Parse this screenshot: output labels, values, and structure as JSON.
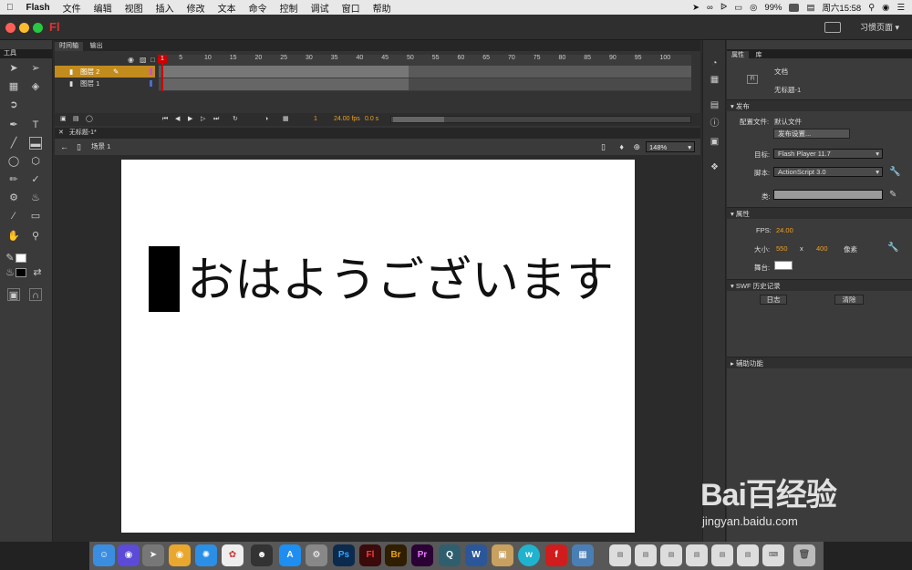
{
  "menubar": {
    "app": "Flash",
    "items": [
      "文件",
      "编辑",
      "视图",
      "插入",
      "修改",
      "文本",
      "命令",
      "控制",
      "调试",
      "窗口",
      "帮助"
    ],
    "battery": "99%",
    "clock": "周六15:58"
  },
  "titlebar": {
    "logo": "Fl",
    "workspace": "习惯页面 ▾"
  },
  "tools": {
    "title": "工具"
  },
  "timeline": {
    "tabs": [
      "时间轴",
      "输出"
    ],
    "layers": [
      "图层 2",
      "图层 1"
    ],
    "ticks": [
      "1",
      "5",
      "10",
      "15",
      "20",
      "25",
      "30",
      "35",
      "40",
      "45",
      "50",
      "55",
      "60",
      "65",
      "70",
      "75",
      "80",
      "85",
      "90",
      "95",
      "100"
    ],
    "current_frame": "1",
    "fps": "24.00 fps",
    "time": "0.0 s"
  },
  "document": {
    "tab": "无标题-1*",
    "scene": "场景 1",
    "zoom": "148%",
    "stage_text": "おはようございます"
  },
  "properties": {
    "tabs": [
      "属性",
      "库"
    ],
    "doc_label": "文档",
    "doc_name": "无标题-1",
    "publish_section": "发布",
    "profile_label": "配置文件:",
    "profile_value": "默认文件",
    "publish_settings_button": "发布设置...",
    "target_label": "目标:",
    "target_value": "Flash Player 11.7",
    "script_label": "脚本:",
    "script_value": "ActionScript 3.0",
    "class_label": "类:",
    "props_section": "属性",
    "fps_label": "FPS:",
    "fps_value": "24.00",
    "size_label": "大小:",
    "width": "550",
    "x": "x",
    "height": "400",
    "unit": "像素",
    "stage_label": "舞台:",
    "swf_section": "SWF 历史记录",
    "log_button": "日志",
    "clear_button": "清除",
    "accessibility_section": "辅助功能"
  },
  "dock": {
    "apps": [
      "Ps",
      "Fl",
      "Br",
      "Pr",
      "W"
    ]
  },
  "watermark": {
    "brand": "Bai百经验",
    "url": "jingyan.baidu.com"
  },
  "colors": {
    "accent": "#f0a020",
    "layer_selected": "#c28b1d",
    "flash_red": "#cc2222"
  }
}
